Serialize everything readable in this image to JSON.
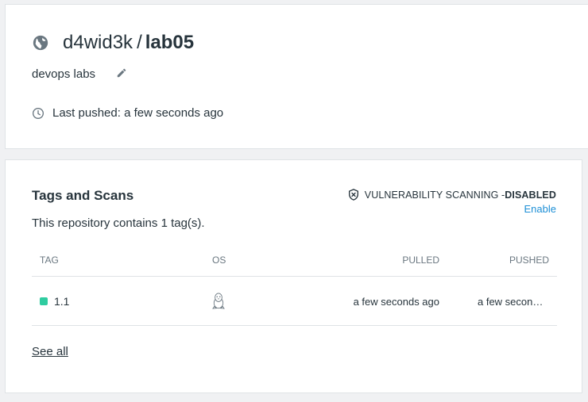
{
  "repo": {
    "namespace": "d4wid3k",
    "slash": "/",
    "name": "lab05",
    "description": "devops labs",
    "last_pushed": "Last pushed: a few seconds ago"
  },
  "tags_section": {
    "title": "Tags and Scans",
    "count_text": "This repository contains 1 tag(s).",
    "vuln_label": "VULNERABILITY SCANNING - ",
    "vuln_status": "DISABLED",
    "enable_label": "Enable",
    "columns": [
      "TAG",
      "OS",
      "PULLED",
      "PUSHED"
    ],
    "rows": [
      {
        "tag": "1.1",
        "os": "linux-icon",
        "pulled": "a few seconds ago",
        "pushed": "a few seconds ago"
      }
    ],
    "see_all": "See all"
  },
  "colors": {
    "accent": "#1d8fd6",
    "status_dot": "#2fcca0",
    "text": "#27343c",
    "muted": "#6a7780"
  }
}
